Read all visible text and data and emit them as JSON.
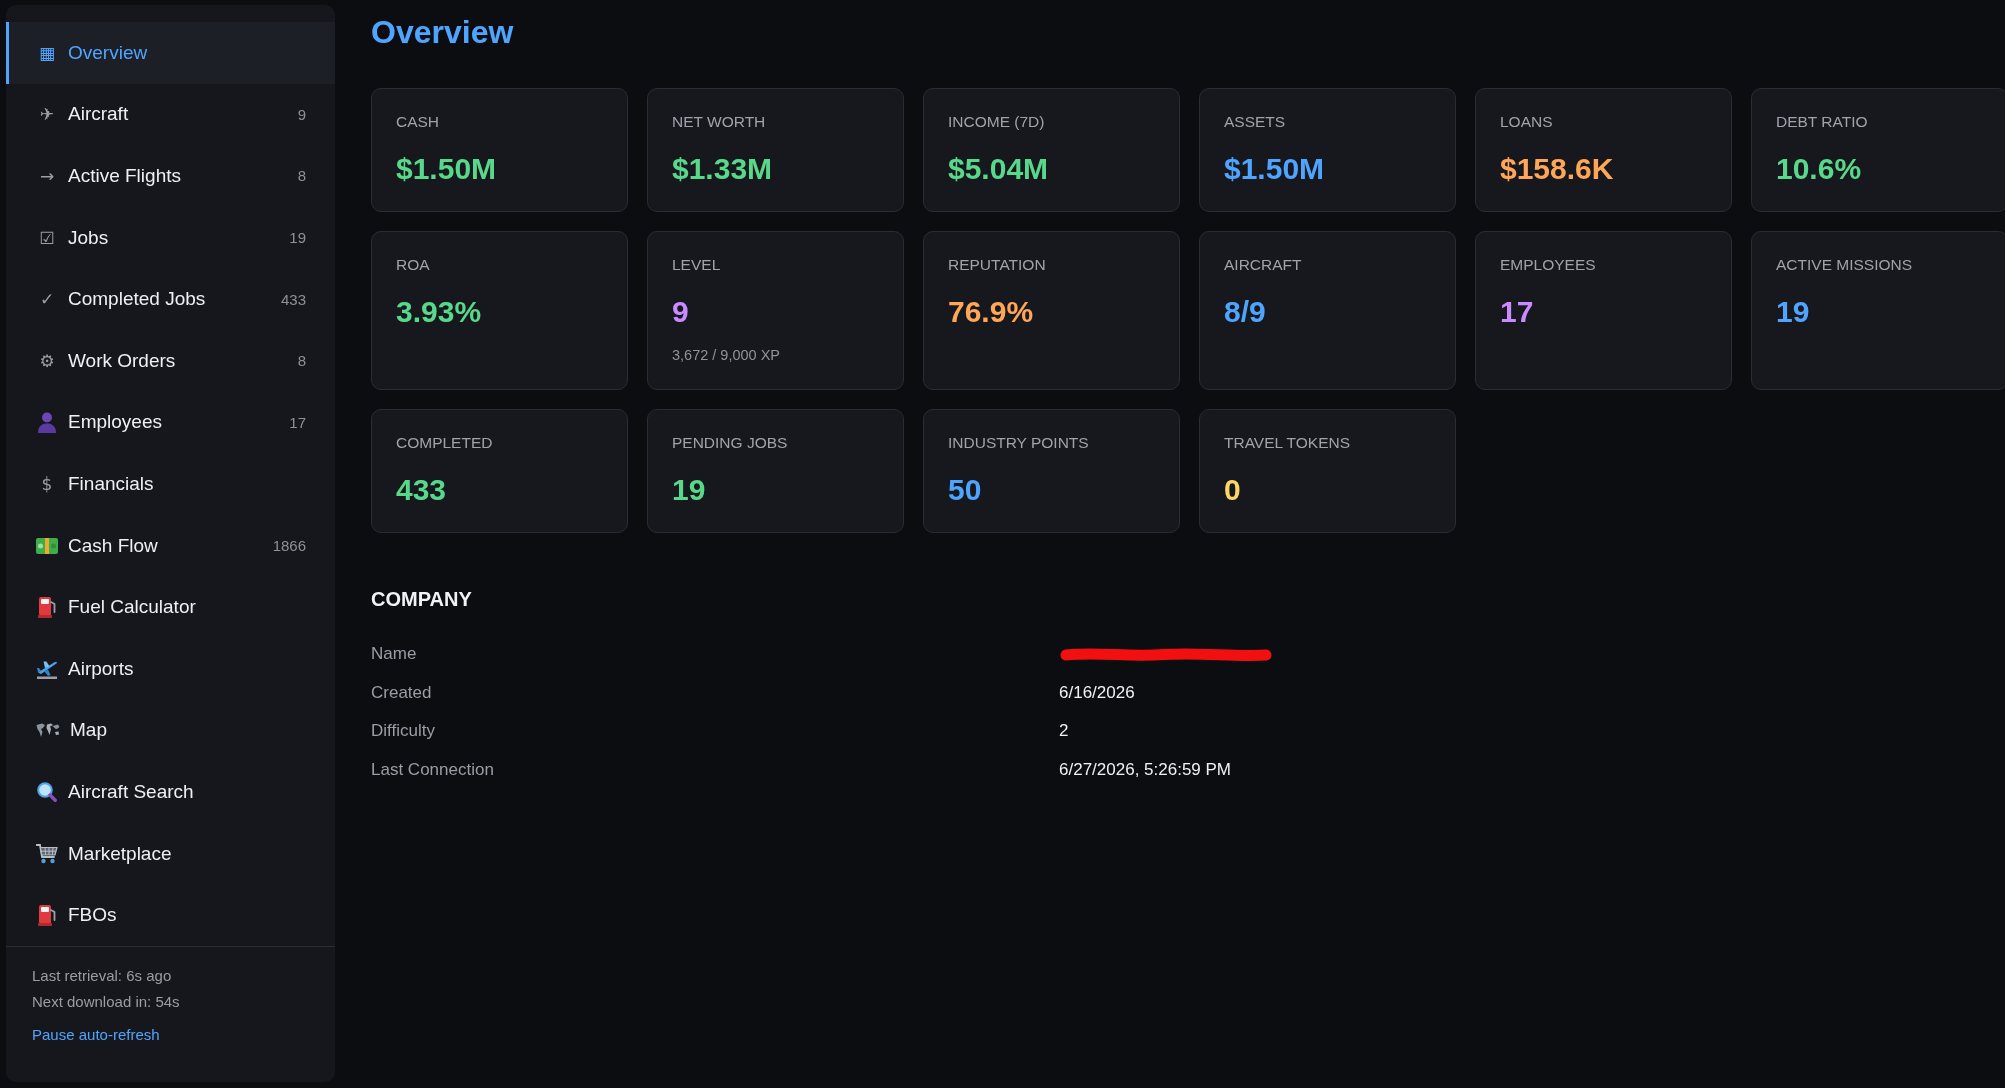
{
  "sidebar": {
    "items": [
      {
        "label": "Overview",
        "glyph": "▦",
        "selected": true
      },
      {
        "label": "Aircraft",
        "glyph": "✈",
        "count": "9",
        "selected": false
      },
      {
        "label": "Active Flights",
        "glyph": "→",
        "count": "8",
        "selected": false
      },
      {
        "label": "Jobs",
        "glyph": "☑",
        "count": "19",
        "selected": false
      },
      {
        "label": "Completed Jobs",
        "glyph": "✓",
        "count": "433",
        "selected": false
      },
      {
        "label": "Work Orders",
        "glyph": "⚙",
        "count": "8",
        "selected": false
      },
      {
        "label": "Employees",
        "count": "17",
        "selected": false
      },
      {
        "label": "Financials",
        "glyph": "$",
        "selected": false
      },
      {
        "label": "Cash Flow",
        "count": "1866",
        "selected": false
      },
      {
        "label": "Fuel Calculator",
        "selected": false
      },
      {
        "label": "Airports",
        "selected": false
      },
      {
        "label": "Map",
        "selected": false
      },
      {
        "label": "Aircraft Search",
        "selected": false
      },
      {
        "label": "Marketplace",
        "selected": false
      },
      {
        "label": "FBOs",
        "selected": false
      }
    ],
    "footer": {
      "lines": [
        "Last retrieval: 6s ago",
        "Next download in: 54s"
      ],
      "link": "Pause auto-refresh"
    }
  },
  "page": {
    "title": "Overview"
  },
  "stats": [
    {
      "label": "CASH",
      "value": "$1.50M",
      "color": "#57d98b"
    },
    {
      "label": "NET WORTH",
      "value": "$1.33M",
      "color": "#57d98b"
    },
    {
      "label": "INCOME (7D)",
      "value": "$5.04M",
      "color": "#57d98b"
    },
    {
      "label": "ASSETS",
      "value": "$1.50M",
      "color": "#4ea5ff"
    },
    {
      "label": "LOANS",
      "value": "$158.6K",
      "color": "#ffa657"
    },
    {
      "label": "DEBT RATIO",
      "value": "10.6%",
      "color": "#57d98b"
    },
    {
      "label": "ROA",
      "value": "3.93%",
      "color": "#57d98b"
    },
    {
      "label": "LEVEL",
      "value": "9",
      "color": "#c98bff",
      "detail": "3,672 / 9,000 XP"
    },
    {
      "label": "REPUTATION",
      "value": "76.9%",
      "color": "#ffa657"
    },
    {
      "label": "AIRCRAFT",
      "value": "8/9",
      "color": "#4ea5ff"
    },
    {
      "label": "EMPLOYEES",
      "value": "17",
      "color": "#c98bff"
    },
    {
      "label": "ACTIVE MISSIONS",
      "value": "19",
      "color": "#4ea5ff"
    },
    {
      "label": "COMPLETED",
      "value": "433",
      "color": "#57d98b"
    },
    {
      "label": "PENDING JOBS",
      "value": "19",
      "color": "#57d98b"
    },
    {
      "label": "INDUSTRY POINTS",
      "value": "50",
      "color": "#4ea5ff"
    },
    {
      "label": "TRAVEL TOKENS",
      "value": "0",
      "color": "#fdd663"
    }
  ],
  "company": {
    "heading": "COMPANY",
    "rows": [
      {
        "label": "Name",
        "kind": "redacted"
      },
      {
        "label": "Created",
        "kind": "text",
        "value": "6/16/2026"
      },
      {
        "label": "Difficulty",
        "kind": "text",
        "value": "2"
      },
      {
        "label": "Last Connection",
        "kind": "text",
        "value": "6/27/2026, 5:26:59 PM"
      }
    ]
  }
}
